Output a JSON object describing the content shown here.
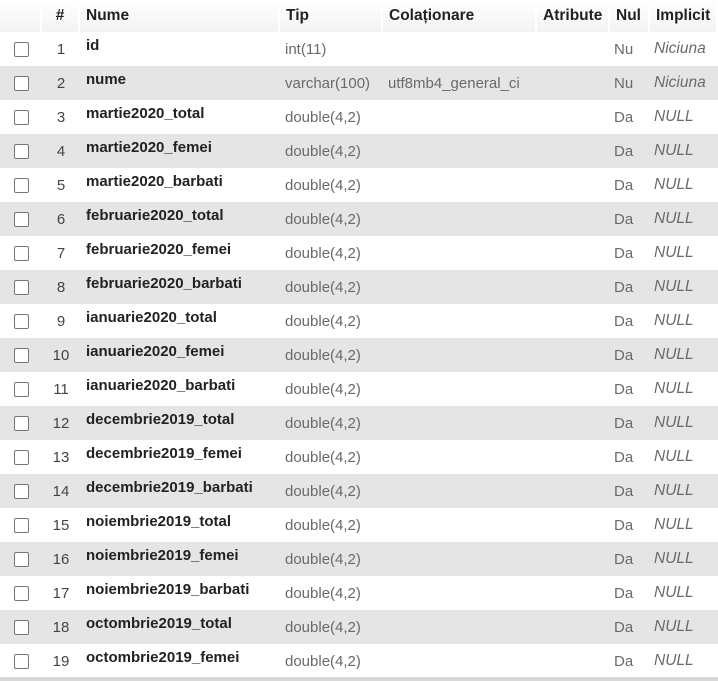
{
  "headers": {
    "num": "#",
    "name": "Nume",
    "type": "Tip",
    "collation": "Colaționare",
    "attributes": "Atribute",
    "null": "Nul",
    "default": "Implicit"
  },
  "rows": [
    {
      "num": "1",
      "name": "id",
      "type": "int(11)",
      "collation": "",
      "attributes": "",
      "null": "Nu",
      "default": "Niciuna"
    },
    {
      "num": "2",
      "name": "nume",
      "type": "varchar(100)",
      "collation": "utf8mb4_general_ci",
      "attributes": "",
      "null": "Nu",
      "default": "Niciuna"
    },
    {
      "num": "3",
      "name": "martie2020_total",
      "type": "double(4,2)",
      "collation": "",
      "attributes": "",
      "null": "Da",
      "default": "NULL"
    },
    {
      "num": "4",
      "name": "martie2020_femei",
      "type": "double(4,2)",
      "collation": "",
      "attributes": "",
      "null": "Da",
      "default": "NULL"
    },
    {
      "num": "5",
      "name": "martie2020_barbati",
      "type": "double(4,2)",
      "collation": "",
      "attributes": "",
      "null": "Da",
      "default": "NULL"
    },
    {
      "num": "6",
      "name": "februarie2020_total",
      "type": "double(4,2)",
      "collation": "",
      "attributes": "",
      "null": "Da",
      "default": "NULL"
    },
    {
      "num": "7",
      "name": "februarie2020_femei",
      "type": "double(4,2)",
      "collation": "",
      "attributes": "",
      "null": "Da",
      "default": "NULL"
    },
    {
      "num": "8",
      "name": "februarie2020_barbati",
      "type": "double(4,2)",
      "collation": "",
      "attributes": "",
      "null": "Da",
      "default": "NULL"
    },
    {
      "num": "9",
      "name": "ianuarie2020_total",
      "type": "double(4,2)",
      "collation": "",
      "attributes": "",
      "null": "Da",
      "default": "NULL"
    },
    {
      "num": "10",
      "name": "ianuarie2020_femei",
      "type": "double(4,2)",
      "collation": "",
      "attributes": "",
      "null": "Da",
      "default": "NULL"
    },
    {
      "num": "11",
      "name": "ianuarie2020_barbati",
      "type": "double(4,2)",
      "collation": "",
      "attributes": "",
      "null": "Da",
      "default": "NULL"
    },
    {
      "num": "12",
      "name": "decembrie2019_total",
      "type": "double(4,2)",
      "collation": "",
      "attributes": "",
      "null": "Da",
      "default": "NULL"
    },
    {
      "num": "13",
      "name": "decembrie2019_femei",
      "type": "double(4,2)",
      "collation": "",
      "attributes": "",
      "null": "Da",
      "default": "NULL"
    },
    {
      "num": "14",
      "name": "decembrie2019_barbati",
      "type": "double(4,2)",
      "collation": "",
      "attributes": "",
      "null": "Da",
      "default": "NULL"
    },
    {
      "num": "15",
      "name": "noiembrie2019_total",
      "type": "double(4,2)",
      "collation": "",
      "attributes": "",
      "null": "Da",
      "default": "NULL"
    },
    {
      "num": "16",
      "name": "noiembrie2019_femei",
      "type": "double(4,2)",
      "collation": "",
      "attributes": "",
      "null": "Da",
      "default": "NULL"
    },
    {
      "num": "17",
      "name": "noiembrie2019_barbati",
      "type": "double(4,2)",
      "collation": "",
      "attributes": "",
      "null": "Da",
      "default": "NULL"
    },
    {
      "num": "18",
      "name": "octombrie2019_total",
      "type": "double(4,2)",
      "collation": "",
      "attributes": "",
      "null": "Da",
      "default": "NULL"
    },
    {
      "num": "19",
      "name": "octombrie2019_femei",
      "type": "double(4,2)",
      "collation": "",
      "attributes": "",
      "null": "Da",
      "default": "NULL"
    }
  ]
}
